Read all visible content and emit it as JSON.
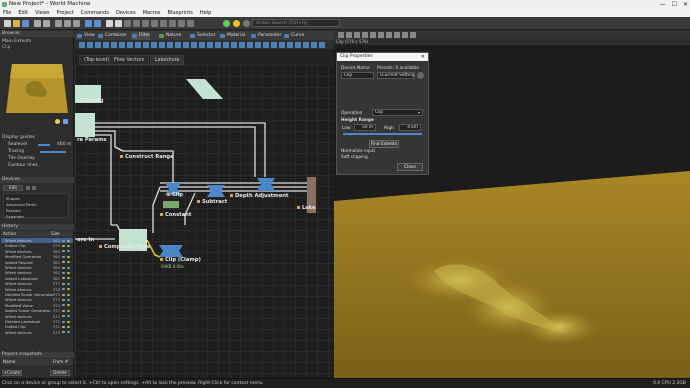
{
  "window": {
    "title": "New Project* - World Machine",
    "controls": [
      "—",
      "☐",
      "✕"
    ]
  },
  "menu": [
    "File",
    "Edit",
    "Views",
    "Project",
    "Commands",
    "Devices",
    "Macros",
    "Blueprints",
    "Help"
  ],
  "search": {
    "placeholder": "Action Search (Ctrl+Q)"
  },
  "tabs": [
    {
      "label": "View",
      "color": "#4a7fb8"
    },
    {
      "label": "Combiner",
      "color": "#4a7fb8"
    },
    {
      "label": "Filter",
      "color": "#4a7fb8"
    },
    {
      "label": "Nature",
      "color": "#5a9a4a"
    },
    {
      "label": "Selector",
      "color": "#4a7fb8"
    },
    {
      "label": "Material",
      "color": "#4a7fb8"
    },
    {
      "label": "Parameter",
      "color": "#4a7fb8"
    },
    {
      "label": "Curve",
      "color": "#4a7fb8"
    }
  ],
  "graph_tabs": [
    "(Top-level)",
    "Flow Vectors",
    "Lakeshore"
  ],
  "browser": {
    "title": "Browser",
    "item": "Main Extents",
    "sub": "Clip"
  },
  "display": {
    "title": "Display guides",
    "sealevel_label": "Sealevel",
    "sealevel_value": "460 m",
    "items": [
      "Tracing",
      "Tile Overlay",
      "Contour lines"
    ]
  },
  "devices": {
    "title": "Devices",
    "edit_label": "Edit",
    "items": [
      "Shapes",
      "Advanced Perlin",
      "Rescale",
      "Expander"
    ]
  },
  "history": {
    "title": "History",
    "columns": [
      "Action",
      "Size"
    ],
    "rows": [
      {
        "action": "Wired devices",
        "size": "382"
      },
      {
        "action": "Edited Clip",
        "size": "379"
      },
      {
        "action": "Wired devices",
        "size": "380"
      },
      {
        "action": "Modified Operation",
        "size": "380"
      },
      {
        "action": "Added Rescale",
        "size": "381"
      },
      {
        "action": "Wired devices",
        "size": "380"
      },
      {
        "action": "Wired devices",
        "size": "382"
      },
      {
        "action": "Added Lakeshore",
        "size": "381"
      },
      {
        "action": "Wired devices",
        "size": "377"
      },
      {
        "action": "Wired devices",
        "size": "376"
      },
      {
        "action": "Deleted Scalar Generator",
        "size": "375"
      },
      {
        "action": "Wired devices",
        "size": "375"
      },
      {
        "action": "Modified Value",
        "size": "374"
      },
      {
        "action": "Added Scalar Generator",
        "size": "377"
      },
      {
        "action": "Wired devices",
        "size": "372"
      },
      {
        "action": "Deleted Lakeshore",
        "size": "372"
      },
      {
        "action": "Edited Clip",
        "size": "371"
      },
      {
        "action": "Wired devices",
        "size": "370"
      }
    ]
  },
  "snapshots": {
    "title": "Project snapshots",
    "col_name": "Name",
    "col_from": "From #",
    "create": "+Create",
    "delete": "Delete"
  },
  "nodes": {
    "shore_config": "re Config",
    "shore_params": "re Params",
    "construct_range": "Construct Range",
    "clip": "Clip",
    "subtract": "Subtract",
    "depth_adjustment": "Depth Adjustment",
    "lake": "Lake",
    "constant": "Constant",
    "composite_type": "Composite Type",
    "shore_in": "ore In",
    "clip_clamp": "Clip (Clamp)",
    "clip_clamp_size": "64KB 0.00s"
  },
  "preview": {
    "hint": "Clip (576 x 576)"
  },
  "dialog": {
    "title": "Clip Properties",
    "device_name_label": "Device Name",
    "device_name_value": "Clip",
    "presets_label": "Presets: 0 available",
    "presets_value": "(Current Settings)",
    "operation_label": "Operation",
    "operation_value": "Clip",
    "height_range_label": "Height Range",
    "low_label": "Low",
    "low_value": "50 m",
    "high_label": "High",
    "high_value": "4 km",
    "find_extents": "Find Extents",
    "normalize": "Normalize input",
    "soft_clip": "Soft clipping",
    "close": "Close"
  },
  "status": {
    "message": "Click on a device or group to select it. +Ctrl to open settings. +Alt to lock the preview. Right-Click for context menu",
    "perf": "0.0 CPU 2.3GB"
  },
  "colors": {
    "node_blue": "#4a86c8",
    "node_mint": "#c5e3d3",
    "node_green": "#7aa86a",
    "terrain": "#9a7a20",
    "terrain_top": "#c6a93a"
  }
}
